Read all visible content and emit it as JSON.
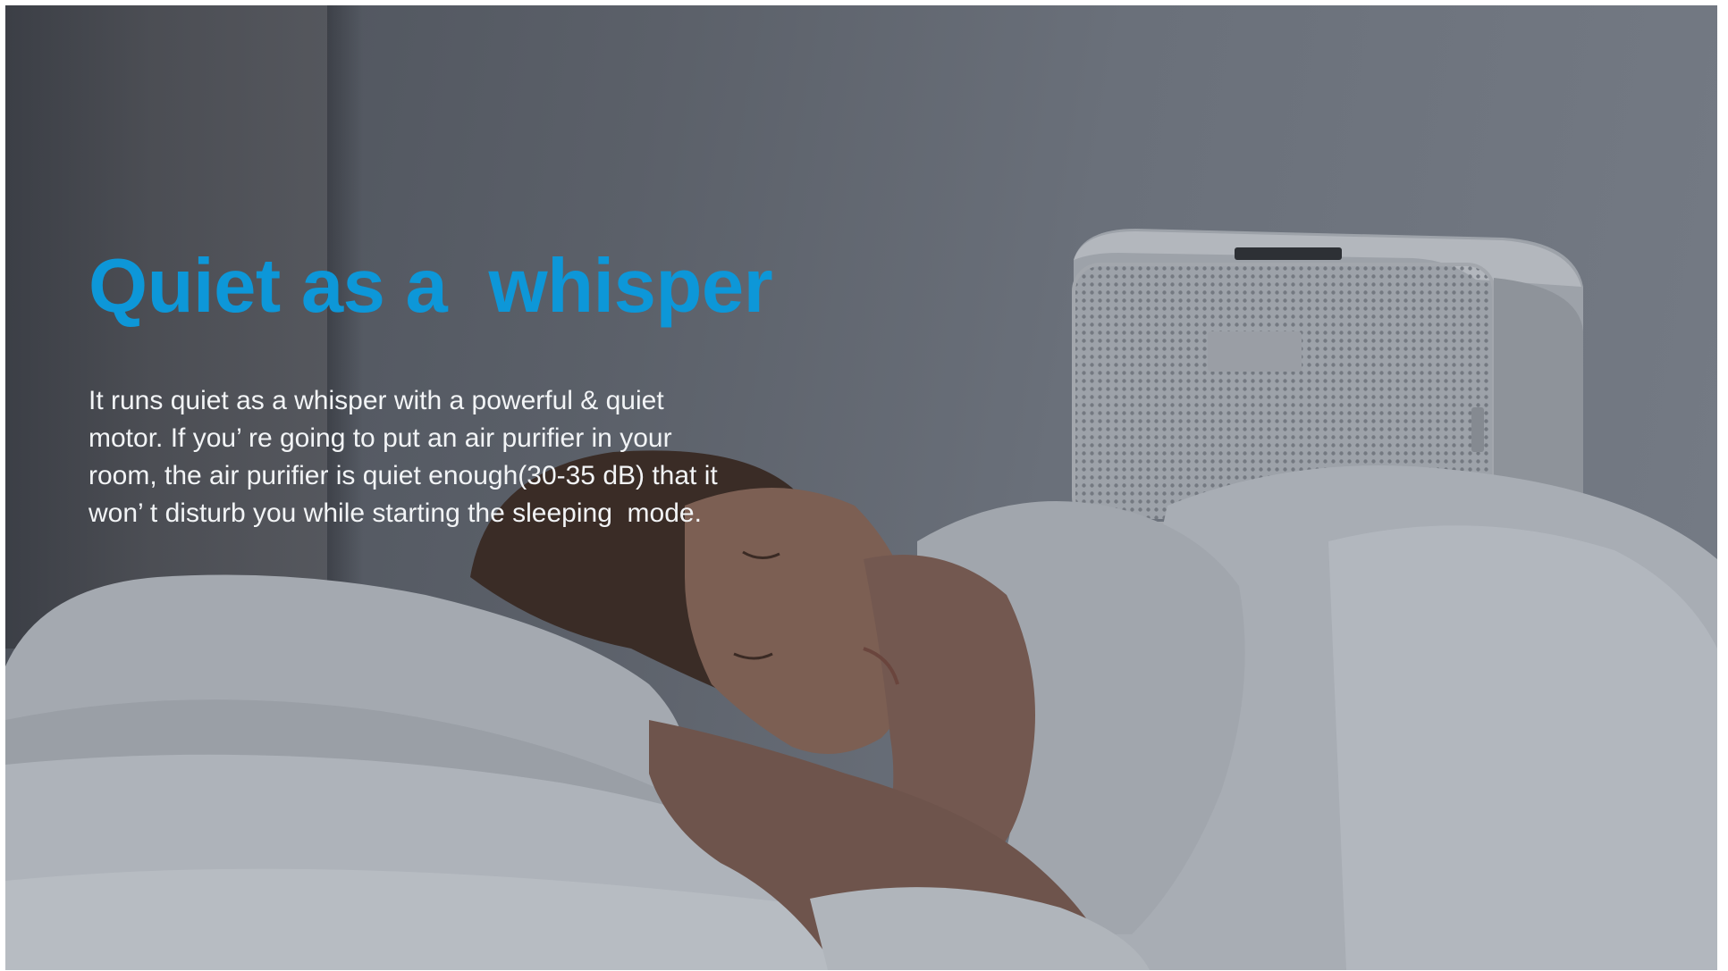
{
  "slide": {
    "headline": "Quiet as a  whisper",
    "body_lines": [
      "It runs quiet as a whisper with a powerful & quiet",
      "motor. If you’ re going to put an air purifier in your",
      "room, the air purifier is quiet enough(30-35 dB) that it",
      "won’ t disturb you while starting the sleeping  mode."
    ]
  },
  "colors": {
    "headline": "#0d97d8",
    "body_text": "#f2f4f6",
    "overlay": "#5b6069"
  }
}
